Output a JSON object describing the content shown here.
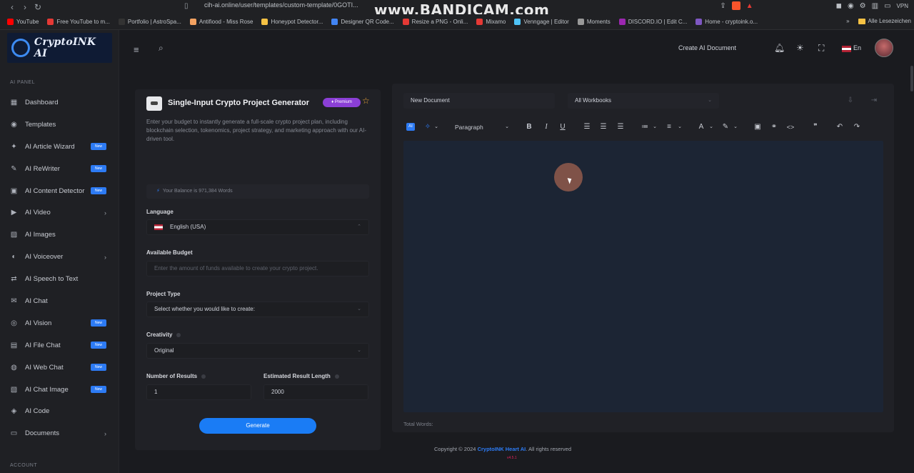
{
  "browser": {
    "url": "cih-ai.online/user/templates/custom-template/0GOTI...",
    "watermark": "www.BANDICAM.com",
    "vpn_label": "VPN",
    "bookmarks": [
      {
        "label": "YouTube",
        "color": "#ff0000"
      },
      {
        "label": "Free YouTube to m...",
        "color": "#e53935"
      },
      {
        "label": "Portfolio | AstroSpa...",
        "color": "#333333"
      },
      {
        "label": "Antifiood - Miss Rose",
        "color": "#f4a261"
      },
      {
        "label": "Honeypot Detector...",
        "color": "#f6c244"
      },
      {
        "label": "Designer QR Code...",
        "color": "#4285f4"
      },
      {
        "label": "Resize a PNG - Onli...",
        "color": "#e53935"
      },
      {
        "label": "Mixamo",
        "color": "#e53935"
      },
      {
        "label": "Venngage | Editor",
        "color": "#4fc3f7"
      },
      {
        "label": "Moments",
        "color": "#999999"
      },
      {
        "label": "DISCORD.IO | Edit C...",
        "color": "#9c27b0"
      },
      {
        "label": "Home - cryptoink.o...",
        "color": "#7e57c2"
      }
    ],
    "bookmarks_more": "»",
    "all_bookmarks": "Alle Lesezeichen"
  },
  "sidebar": {
    "logo_text": "CryptoINK AI",
    "section_ai_panel": "AI PANEL",
    "section_account": "ACCOUNT",
    "items": [
      {
        "label": "Dashboard",
        "icon": "dashboard-icon",
        "glyph": "▦",
        "badge": "",
        "chevron": false
      },
      {
        "label": "Templates",
        "icon": "templates-icon",
        "glyph": "◉",
        "badge": "",
        "chevron": false
      },
      {
        "label": "AI Article Wizard",
        "icon": "wizard-icon",
        "glyph": "✦",
        "badge": "New",
        "chevron": false
      },
      {
        "label": "AI ReWriter",
        "icon": "pen-icon",
        "glyph": "✎",
        "badge": "New",
        "chevron": false
      },
      {
        "label": "AI Content Detector",
        "icon": "detector-icon",
        "glyph": "▣",
        "badge": "New",
        "chevron": false
      },
      {
        "label": "AI Video",
        "icon": "video-icon",
        "glyph": "▶",
        "badge": "",
        "chevron": true
      },
      {
        "label": "AI Images",
        "icon": "images-icon",
        "glyph": "▨",
        "badge": "",
        "chevron": false
      },
      {
        "label": "AI Voiceover",
        "icon": "voiceover-icon",
        "glyph": "◐",
        "badge": "",
        "chevron": true
      },
      {
        "label": "AI Speech to Text",
        "icon": "speech-icon",
        "glyph": "⇄",
        "badge": "",
        "chevron": false
      },
      {
        "label": "AI Chat",
        "icon": "chat-icon",
        "glyph": "✉",
        "badge": "",
        "chevron": false
      },
      {
        "label": "AI Vision",
        "icon": "vision-icon",
        "glyph": "◎",
        "badge": "New",
        "chevron": false
      },
      {
        "label": "AI File Chat",
        "icon": "file-chat-icon",
        "glyph": "▤",
        "badge": "New",
        "chevron": false
      },
      {
        "label": "AI Web Chat",
        "icon": "web-chat-icon",
        "glyph": "◍",
        "badge": "New",
        "chevron": false
      },
      {
        "label": "AI Chat Image",
        "icon": "chat-image-icon",
        "glyph": "▧",
        "badge": "New",
        "chevron": false
      },
      {
        "label": "AI Code",
        "icon": "code-icon",
        "glyph": "◈",
        "badge": "",
        "chevron": false
      },
      {
        "label": "Documents",
        "icon": "documents-icon",
        "glyph": "▭",
        "badge": "",
        "chevron": true
      }
    ]
  },
  "topbar": {
    "create_doc": "Create AI Document",
    "language": "En"
  },
  "generator": {
    "title": "Single-Input Crypto Project Generator",
    "premium_label": "Premium",
    "description": "Enter your budget to instantly generate a full-scale crypto project plan, including blockchain selection, tokenomics, project strategy, and marketing approach with our AI-driven tool.",
    "balance": "Your Balance is 971,384 Words",
    "language_label": "Language",
    "language_value": "English (USA)",
    "budget_label": "Available Budget",
    "budget_placeholder": "Enter the amount of funds available to create your crypto project.",
    "project_type_label": "Project Type",
    "project_type_value": "Select whether you would like to create:",
    "creativity_label": "Creativity",
    "creativity_value": "Original",
    "results_label": "Number of Results",
    "results_value": "1",
    "length_label": "Estimated Result Length",
    "length_value": "2000",
    "generate_label": "Generate"
  },
  "editor": {
    "doc_name": "New Document",
    "workbook": "All Workbooks",
    "paragraph": "Paragraph",
    "ai_label": "AI",
    "total_words": "Total Words:"
  },
  "footer": {
    "copyright_prefix": "Copyright © 2024",
    "brand": "CryptoINK Heart AI",
    "suffix": ". All rights reserved",
    "version": "v4.5.1"
  }
}
